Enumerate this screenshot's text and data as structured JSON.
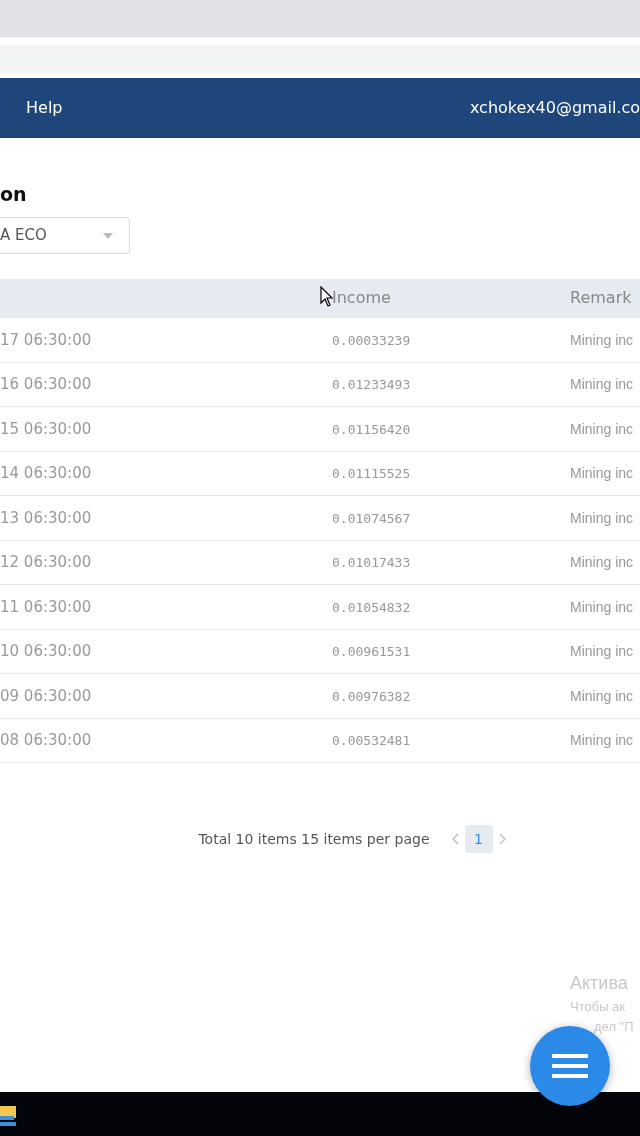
{
  "navbar": {
    "links": [
      "Help"
    ],
    "account": "xchokex40@gmail.co"
  },
  "page": {
    "title": "on",
    "select": {
      "value": "A ECO"
    }
  },
  "table": {
    "columns": [
      "Income",
      "Remark"
    ],
    "rows": [
      {
        "date": "17 06:30:00",
        "income": "0.00033239",
        "remark": "Mining inc"
      },
      {
        "date": "16 06:30:00",
        "income": "0.01233493",
        "remark": "Mining inc"
      },
      {
        "date": "15 06:30:00",
        "income": "0.01156420",
        "remark": "Mining inc"
      },
      {
        "date": "14 06:30:00",
        "income": "0.01115525",
        "remark": "Mining inc"
      },
      {
        "date": "13 06:30:00",
        "income": "0.01074567",
        "remark": "Mining inc"
      },
      {
        "date": "12 06:30:00",
        "income": "0.01017433",
        "remark": "Mining inc"
      },
      {
        "date": "11 06:30:00",
        "income": "0.01054832",
        "remark": "Mining inc"
      },
      {
        "date": "10 06:30:00",
        "income": "0.00961531",
        "remark": "Mining inc"
      },
      {
        "date": "09 06:30:00",
        "income": "0.00976382",
        "remark": "Mining inc"
      },
      {
        "date": "08 06:30:00",
        "income": "0.00532481",
        "remark": "Mining inc"
      }
    ]
  },
  "pagination": {
    "summary": "Total 10 items 15 items per page",
    "pages": [
      {
        "label": "1",
        "selected": true
      }
    ]
  },
  "activation_notice": {
    "title": "Актива",
    "lines": [
      "Чтобы ак",
      "дел \"П"
    ]
  }
}
